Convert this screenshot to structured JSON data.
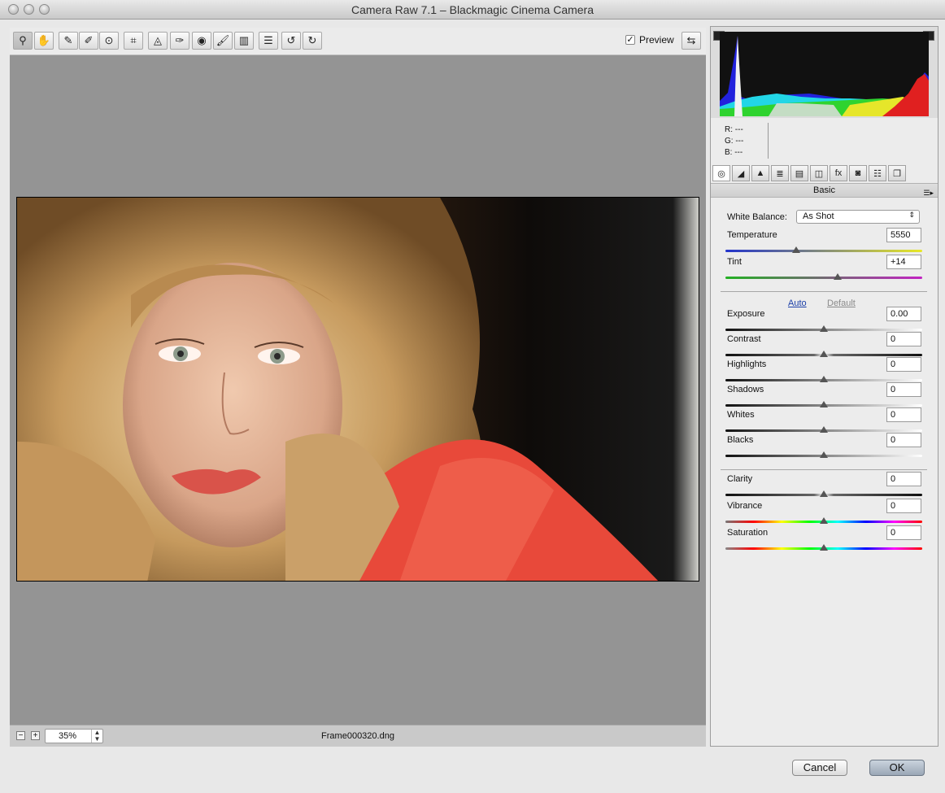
{
  "window": {
    "title": "Camera Raw 7.1  –  Blackmagic Cinema Camera"
  },
  "toolbar": {
    "tools": [
      {
        "name": "zoom-tool-icon",
        "glyph": "⚲"
      },
      {
        "name": "hand-tool-icon",
        "glyph": "✋"
      },
      {
        "name": "white-balance-tool-icon",
        "glyph": "✎"
      },
      {
        "name": "color-sampler-tool-icon",
        "glyph": "✐"
      },
      {
        "name": "targeted-adjustment-tool-icon",
        "glyph": "⊙"
      },
      {
        "name": "crop-tool-icon",
        "glyph": "⌗"
      },
      {
        "name": "straighten-tool-icon",
        "glyph": "◬"
      },
      {
        "name": "spot-removal-tool-icon",
        "glyph": "✑"
      },
      {
        "name": "red-eye-removal-tool-icon",
        "glyph": "◉"
      },
      {
        "name": "adjustment-brush-tool-icon",
        "glyph": "🖌"
      },
      {
        "name": "graduated-filter-tool-icon",
        "glyph": "▥"
      },
      {
        "name": "preferences-icon",
        "glyph": "☰"
      },
      {
        "name": "rotate-left-icon",
        "glyph": "↺"
      },
      {
        "name": "rotate-right-icon",
        "glyph": "↻"
      }
    ],
    "preview_label": "Preview",
    "preview_checked": "✓",
    "fullscreen_glyph": "⇆"
  },
  "status": {
    "zoom_out": "−",
    "zoom_in": "+",
    "zoom_value": "35%",
    "filename": "Frame000320.dng"
  },
  "panel": {
    "rgb": {
      "r": "R:  ---",
      "g": "G:  ---",
      "b": "B:  ---"
    },
    "tabs": [
      {
        "name": "basic-tab-icon",
        "glyph": "◎"
      },
      {
        "name": "tone-curve-tab-icon",
        "glyph": "◢"
      },
      {
        "name": "detail-tab-icon",
        "glyph": "▲"
      },
      {
        "name": "hsl-tab-icon",
        "glyph": "≣"
      },
      {
        "name": "split-toning-tab-icon",
        "glyph": "▤"
      },
      {
        "name": "lens-corrections-tab-icon",
        "glyph": "◫"
      },
      {
        "name": "effects-tab-icon",
        "glyph": "fx"
      },
      {
        "name": "camera-calibration-tab-icon",
        "glyph": "◙"
      },
      {
        "name": "presets-tab-icon",
        "glyph": "☷"
      },
      {
        "name": "snapshots-tab-icon",
        "glyph": "❐"
      }
    ],
    "section_title": "Basic",
    "white_balance_label": "White Balance:",
    "white_balance_value": "As Shot",
    "auto_label": "Auto",
    "default_label": "Default",
    "controls": [
      {
        "label": "Temperature",
        "value": "5550",
        "position": 0.36
      },
      {
        "label": "Tint",
        "value": "+14",
        "position": 0.57
      },
      {
        "label": "Exposure",
        "value": "0.00",
        "position": 0.5
      },
      {
        "label": "Contrast",
        "value": "0",
        "position": 0.5
      },
      {
        "label": "Highlights",
        "value": "0",
        "position": 0.5
      },
      {
        "label": "Shadows",
        "value": "0",
        "position": 0.5
      },
      {
        "label": "Whites",
        "value": "0",
        "position": 0.5
      },
      {
        "label": "Blacks",
        "value": "0",
        "position": 0.5
      },
      {
        "label": "Clarity",
        "value": "0",
        "position": 0.5
      },
      {
        "label": "Vibrance",
        "value": "0",
        "position": 0.5
      },
      {
        "label": "Saturation",
        "value": "0",
        "position": 0.5
      }
    ]
  },
  "buttons": {
    "cancel": "Cancel",
    "ok": "OK"
  }
}
